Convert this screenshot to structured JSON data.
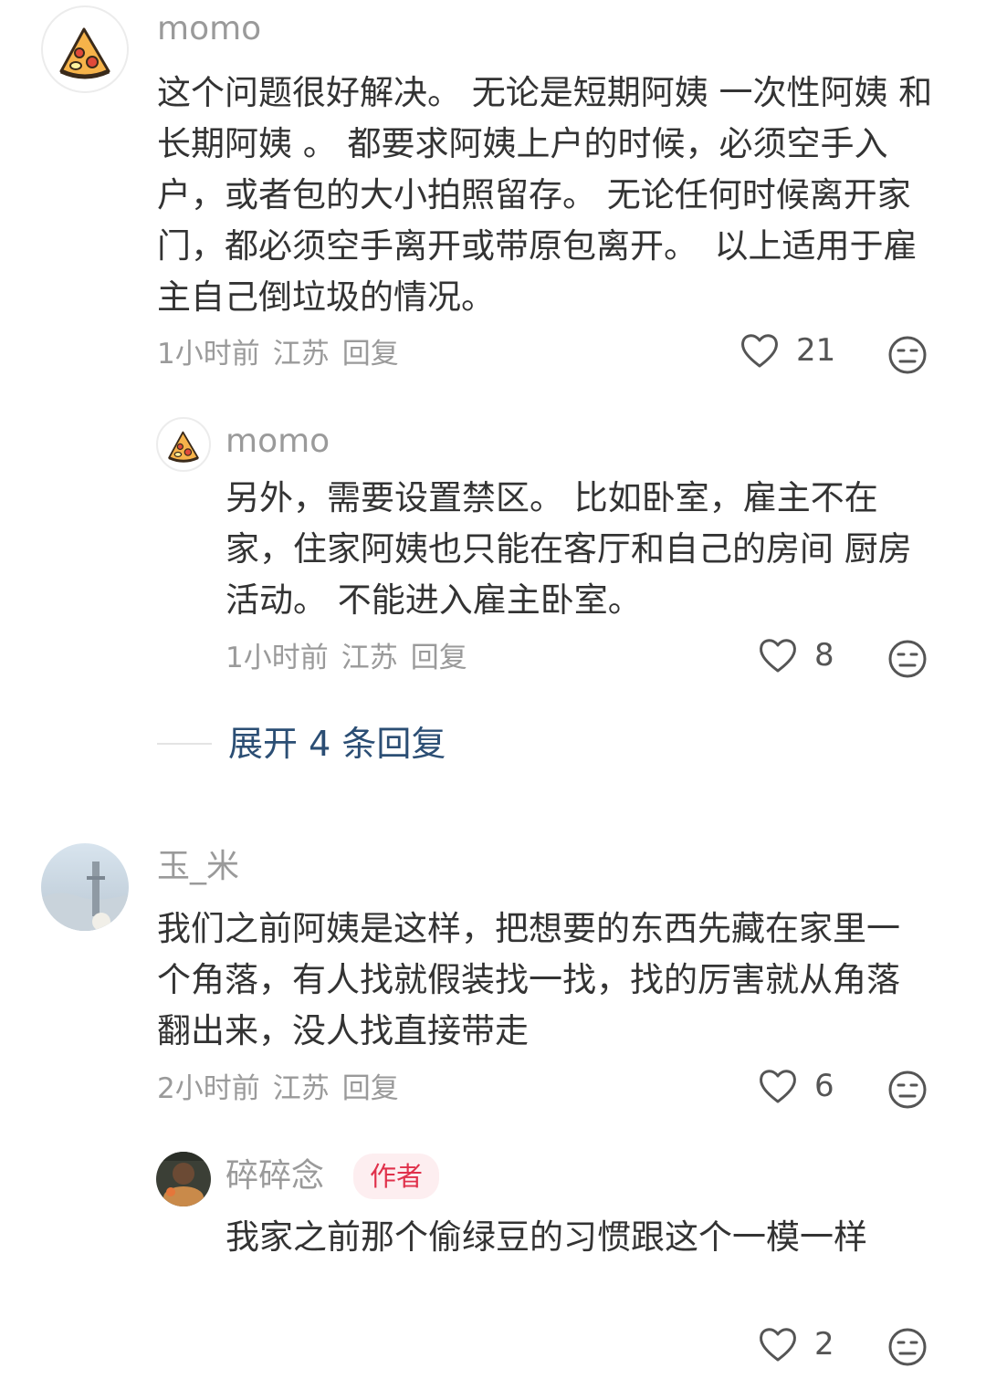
{
  "comments": [
    {
      "username": "momo",
      "text": "这个问题很好解决。 无论是短期阿姨 一次性阿姨 和长期阿姨 。 都要求阿姨上户的时候，必须空手入户，或者包的大小拍照留存。 无论任何时候离开家门，都必须空手离开或带原包离开。　以上适用于雇主自己倒垃圾的情况。",
      "time": "1小时前",
      "location": "江苏",
      "reply_label": "回复",
      "likes": "21",
      "avatar_icon": "pizza-icon",
      "replies": [
        {
          "username": "momo",
          "text": "另外，需要设置禁区。 比如卧室，雇主不在家，住家阿姨也只能在客厅和自己的房间 厨房活动。 不能进入雇主卧室。",
          "time": "1小时前",
          "location": "江苏",
          "reply_label": "回复",
          "likes": "8",
          "avatar_icon": "pizza-icon"
        }
      ],
      "expand_label": "展开 4 条回复"
    },
    {
      "username": "玉_米",
      "text": "我们之前阿姨是这样，把想要的东西先藏在家里一个角落，有人找就假装找一找，找的厉害就从角落翻出来，没人找直接带走",
      "time": "2小时前",
      "location": "江苏",
      "reply_label": "回复",
      "likes": "6",
      "avatar_icon": "photo-avatar",
      "replies": [
        {
          "username": "碎碎念",
          "badge": "作者",
          "text": "我家之前那个偷绿豆的习惯跟这个一模一样",
          "likes": "2",
          "avatar_icon": "photo-avatar"
        }
      ]
    }
  ],
  "colors": {
    "link": "#2b4e74",
    "muted": "#9a9a9a",
    "badge_text": "#e0314b",
    "badge_bg": "#fdeef0"
  }
}
